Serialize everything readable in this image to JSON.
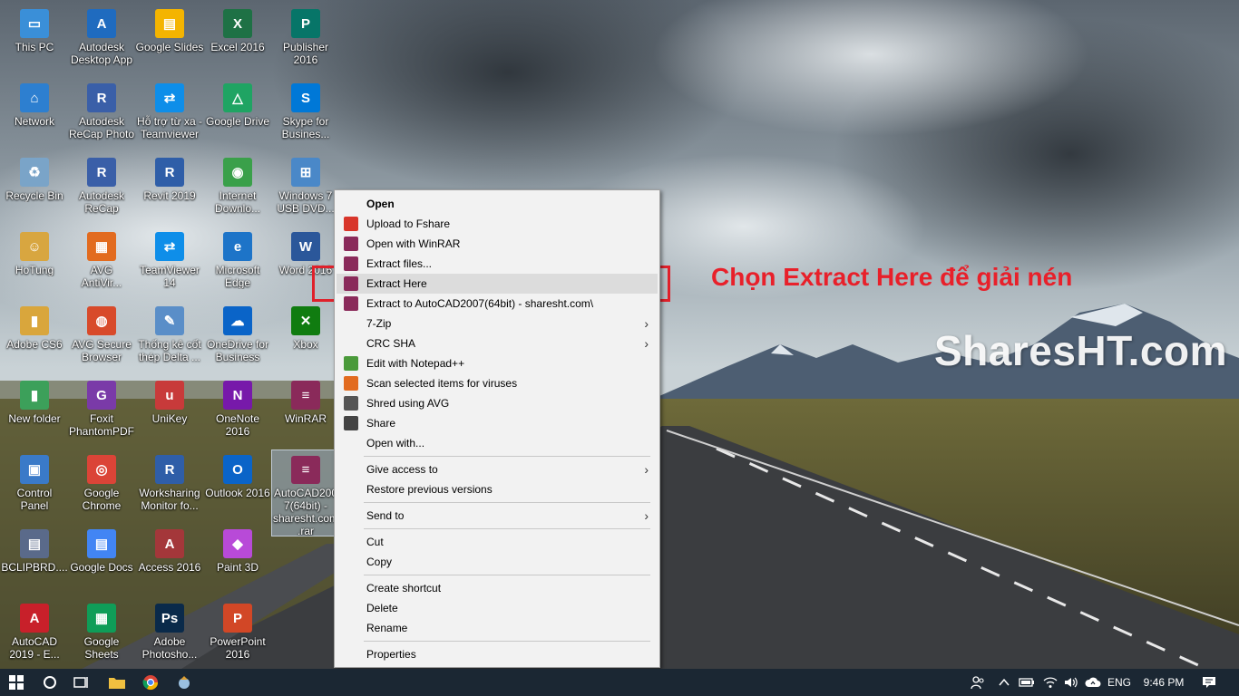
{
  "desktop": {
    "icons": [
      {
        "label": "This PC",
        "glyph": "▭",
        "color": "#3a8fd8",
        "icon": "computer-icon"
      },
      {
        "label": "Autodesk\nDesktop App",
        "glyph": "A",
        "color": "#1f6bbf",
        "icon": "autodesk-app-icon"
      },
      {
        "label": "Google Slides",
        "glyph": "▤",
        "color": "#f4b400",
        "icon": "google-slides-icon"
      },
      {
        "label": "Excel 2016",
        "glyph": "X",
        "color": "#1e7145",
        "icon": "excel-icon"
      },
      {
        "label": "Publisher\n2016",
        "glyph": "P",
        "color": "#077568",
        "icon": "publisher-icon"
      },
      {
        "label": "Network",
        "glyph": "⌂",
        "color": "#2d7fd0",
        "icon": "network-icon"
      },
      {
        "label": "Autodesk\nReCap Photo",
        "glyph": "R",
        "color": "#3a5fa8",
        "icon": "recap-photo-icon"
      },
      {
        "label": "Hỗ trợ từ xa -\nTeamviewer",
        "glyph": "⇄",
        "color": "#0e8ee9",
        "icon": "teamviewer-icon"
      },
      {
        "label": "Google Drive",
        "glyph": "△",
        "color": "#1fa463",
        "icon": "google-drive-icon"
      },
      {
        "label": "Skype for\nBusines...",
        "glyph": "S",
        "color": "#0078d7",
        "icon": "skype-icon"
      },
      {
        "label": "Recycle Bin",
        "glyph": "♻",
        "color": "#7aa4c8",
        "icon": "recycle-bin-icon"
      },
      {
        "label": "Autodesk\nReCap",
        "glyph": "R",
        "color": "#3a5fa8",
        "icon": "recap-icon"
      },
      {
        "label": "Revit 2019",
        "glyph": "R",
        "color": "#2f5ea8",
        "icon": "revit-icon"
      },
      {
        "label": "Internet\nDownlo...",
        "glyph": "◉",
        "color": "#3aa04a",
        "icon": "idm-icon"
      },
      {
        "label": "Windows 7\nUSB DVD...",
        "glyph": "⊞",
        "color": "#4a88c8",
        "icon": "windows-usb-icon"
      },
      {
        "label": "HoTung",
        "glyph": "☺",
        "color": "#d8a640",
        "icon": "user-folder-icon"
      },
      {
        "label": "AVG\nAntiVir...",
        "glyph": "▦",
        "color": "#e26b1f",
        "icon": "avg-antivirus-icon"
      },
      {
        "label": "TeamViewer\n14",
        "glyph": "⇄",
        "color": "#0e8ee9",
        "icon": "teamviewer14-icon"
      },
      {
        "label": "Microsoft\nEdge",
        "glyph": "e",
        "color": "#1d74c8",
        "icon": "edge-icon"
      },
      {
        "label": "Word 2016",
        "glyph": "W",
        "color": "#2b579a",
        "icon": "word-icon"
      },
      {
        "label": "Adobe CS6",
        "glyph": "▮",
        "color": "#d9a63c",
        "icon": "folder-icon"
      },
      {
        "label": "AVG Secure\nBrowser",
        "glyph": "◍",
        "color": "#d84a2a",
        "icon": "avg-browser-icon"
      },
      {
        "label": "Thống kê cốt\nthép Delta ...",
        "glyph": "✎",
        "color": "#5a8ec8",
        "icon": "delta-icon"
      },
      {
        "label": "OneDrive for\nBusiness",
        "glyph": "☁",
        "color": "#0a64c8",
        "icon": "onedrive-icon"
      },
      {
        "label": "Xbox",
        "glyph": "✕",
        "color": "#107c10",
        "icon": "xbox-icon"
      },
      {
        "label": "New folder",
        "glyph": "▮",
        "color": "#3ca05a",
        "icon": "new-folder-icon"
      },
      {
        "label": "Foxit\nPhantomPDF",
        "glyph": "G",
        "color": "#7a3aa8",
        "icon": "foxit-icon"
      },
      {
        "label": "UniKey",
        "glyph": "u",
        "color": "#c83a3a",
        "icon": "unikey-icon"
      },
      {
        "label": "OneNote\n2016",
        "glyph": "N",
        "color": "#7719aa",
        "icon": "onenote-icon"
      },
      {
        "label": "WinRAR",
        "glyph": "≡",
        "color": "#8a2a5a",
        "icon": "winrar-icon"
      },
      {
        "label": "Control\nPanel",
        "glyph": "▣",
        "color": "#3a7ac8",
        "icon": "control-panel-icon"
      },
      {
        "label": "Google\nChrome",
        "glyph": "◎",
        "color": "#db4437",
        "icon": "chrome-icon"
      },
      {
        "label": "Worksharing\nMonitor fo...",
        "glyph": "R",
        "color": "#2f5ea8",
        "icon": "worksharing-icon"
      },
      {
        "label": "Outlook 2016",
        "glyph": "O",
        "color": "#0a64c8",
        "icon": "outlook-icon"
      },
      {
        "label": "AutoCAD200\n7(64bit) -\nsharesht.com\n.rar",
        "glyph": "≡",
        "color": "#8a2a5a",
        "icon": "rar-file-icon"
      },
      {
        "label": "BCLIPBRD....",
        "glyph": "▤",
        "color": "#5a6a8a",
        "icon": "clipboard-icon"
      },
      {
        "label": "Google Docs",
        "glyph": "▤",
        "color": "#4285f4",
        "icon": "google-docs-icon"
      },
      {
        "label": "Access 2016",
        "glyph": "A",
        "color": "#a4373a",
        "icon": "access-icon"
      },
      {
        "label": "Paint 3D",
        "glyph": "◆",
        "color": "#b84ad8",
        "icon": "paint3d-icon"
      },
      {
        "label": "AutoCAD\n2019 - E...",
        "glyph": "A",
        "color": "#c8202a",
        "icon": "autocad-icon"
      },
      {
        "label": "Google\nSheets",
        "glyph": "▦",
        "color": "#0f9d58",
        "icon": "google-sheets-icon"
      },
      {
        "label": "Adobe\nPhotosho...",
        "glyph": "Ps",
        "color": "#0a2a4a",
        "icon": "photoshop-icon"
      },
      {
        "label": "PowerPoint\n2016",
        "glyph": "P",
        "color": "#d24726",
        "icon": "powerpoint-icon"
      }
    ]
  },
  "context_menu": {
    "items": [
      {
        "label": "Open",
        "icon": "",
        "bold": true
      },
      {
        "label": "Upload to Fshare",
        "icon": "fshare-icon",
        "color": "#d8352a"
      },
      {
        "label": "Open with WinRAR",
        "icon": "winrar-icon",
        "color": "#8a2a5a"
      },
      {
        "label": "Extract files...",
        "icon": "winrar-icon",
        "color": "#8a2a5a"
      },
      {
        "label": "Extract Here",
        "icon": "winrar-icon",
        "color": "#8a2a5a",
        "highlighted": true
      },
      {
        "label": "Extract to AutoCAD2007(64bit) - sharesht.com\\",
        "icon": "winrar-icon",
        "color": "#8a2a5a"
      },
      {
        "label": "7-Zip",
        "icon": "",
        "submenu": true
      },
      {
        "label": "CRC SHA",
        "icon": "",
        "submenu": true
      },
      {
        "label": "Edit with Notepad++",
        "icon": "notepadpp-icon",
        "color": "#4a9a3a"
      },
      {
        "label": "Scan selected items for viruses",
        "icon": "avg-icon",
        "color": "#e26b1f"
      },
      {
        "label": "Shred using AVG",
        "icon": "shred-icon",
        "color": "#555555"
      },
      {
        "label": "Share",
        "icon": "share-icon",
        "color": "#444444"
      },
      {
        "label": "Open with...",
        "icon": ""
      },
      {
        "label": "Give access to",
        "icon": "",
        "submenu": true
      },
      {
        "label": "Restore previous versions",
        "icon": ""
      },
      {
        "label": "Send to",
        "icon": "",
        "submenu": true
      },
      {
        "label": "Cut",
        "icon": ""
      },
      {
        "label": "Copy",
        "icon": ""
      },
      {
        "label": "Create shortcut",
        "icon": ""
      },
      {
        "label": "Delete",
        "icon": ""
      },
      {
        "label": "Rename",
        "icon": ""
      },
      {
        "label": "Properties",
        "icon": ""
      }
    ]
  },
  "annotation": {
    "text": "Chọn Extract Here để giải nén",
    "color": "#e8202a"
  },
  "watermark": "SharesHT.com",
  "taskbar": {
    "language": "ENG",
    "time": "9:46 PM"
  }
}
